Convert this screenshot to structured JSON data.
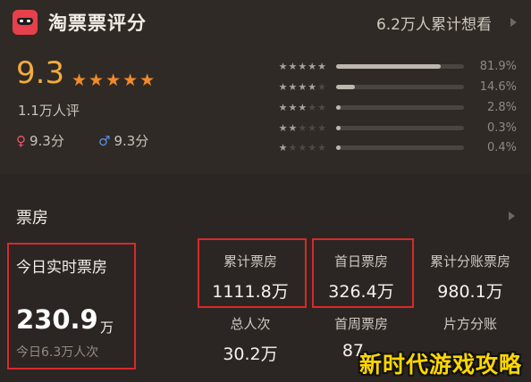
{
  "header": {
    "app_title": "淘票票评分",
    "want_count": "6.2万人累计想看"
  },
  "rating": {
    "score": "9.3",
    "stars": "★★★★★",
    "raters": "1.1万人评",
    "female_symbol": "♀",
    "female_score": "9.3分",
    "male_symbol": "♂",
    "male_score": "9.3分",
    "distribution": [
      {
        "stars": "★★★★★",
        "percent_label": "81.9%",
        "fraction": 0.819
      },
      {
        "stars": "★★★★★",
        "percent_label": "14.6%",
        "fraction": 0.146
      },
      {
        "stars": "★★★★★",
        "percent_label": "2.8%",
        "fraction": 0.028
      },
      {
        "stars": "★★★★★",
        "percent_label": "0.3%",
        "fraction": 0.003
      },
      {
        "stars": "★★★★★",
        "percent_label": "0.4%",
        "fraction": 0.004
      }
    ]
  },
  "box_office": {
    "title": "票房",
    "today_label": "今日实时票房",
    "today_value": "230.9",
    "today_unit": "万",
    "today_viewers": "今日6.3万人次",
    "cells": [
      {
        "label": "累计票房",
        "value": "1111.8万"
      },
      {
        "label": "首日票房",
        "value": "326.4万"
      },
      {
        "label": "累计分账票房",
        "value": "980.1万"
      },
      {
        "label": "总人次",
        "value": "30.2万"
      },
      {
        "label": "首周票房",
        "value": "87..."
      },
      {
        "label": "片方分账",
        "value": "..."
      }
    ]
  },
  "watermark": "新时代游戏攻略",
  "colors": {
    "score": "#f2ab3e",
    "stars": "#f08a2c",
    "highlight_box": "#d72a2a",
    "logo": "#e5404b",
    "watermark": "#ffd700"
  }
}
